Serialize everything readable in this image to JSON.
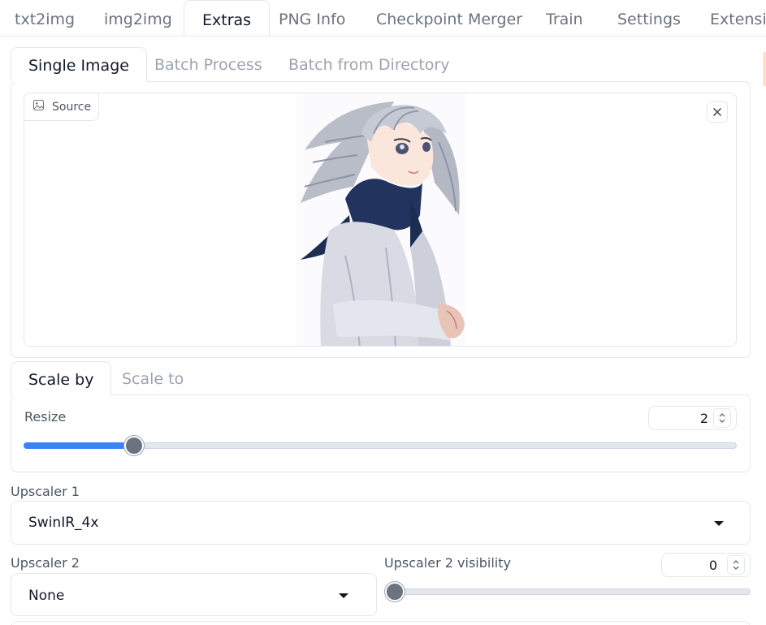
{
  "top_tabs": [
    {
      "label": "txt2img"
    },
    {
      "label": "img2img"
    },
    {
      "label": "Extras"
    },
    {
      "label": "PNG Info"
    },
    {
      "label": "Checkpoint Merger"
    },
    {
      "label": "Train"
    },
    {
      "label": "Settings"
    },
    {
      "label": "Extensions"
    }
  ],
  "image_tabs": [
    {
      "label": "Single Image"
    },
    {
      "label": "Batch Process"
    },
    {
      "label": "Batch from Directory"
    }
  ],
  "source": {
    "label": "Source",
    "image_icon": "image-icon",
    "close_icon": "close-icon"
  },
  "scale_tabs": [
    {
      "label": "Scale by"
    },
    {
      "label": "Scale to"
    }
  ],
  "resize": {
    "label": "Resize",
    "value": "2",
    "min": 1,
    "max": 8,
    "level": 0.155
  },
  "upscaler1": {
    "label": "Upscaler 1",
    "value": "SwinIR_4x"
  },
  "upscaler2": {
    "label": "Upscaler 2",
    "value": "None"
  },
  "upscaler2_visibility": {
    "label": "Upscaler 2 visibility",
    "value": "0",
    "level": 0
  },
  "colors": {
    "accent": "#3b82f6",
    "thumb": "#6b7280",
    "border": "#e5e7eb"
  }
}
